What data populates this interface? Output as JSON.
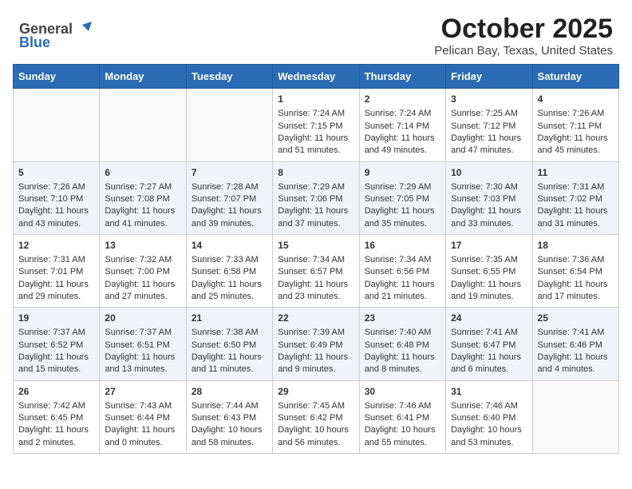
{
  "header": {
    "logo_general": "General",
    "logo_blue": "Blue",
    "title": "October 2025",
    "subtitle": "Pelican Bay, Texas, United States"
  },
  "days_of_week": [
    "Sunday",
    "Monday",
    "Tuesday",
    "Wednesday",
    "Thursday",
    "Friday",
    "Saturday"
  ],
  "weeks": [
    [
      {
        "day": "",
        "content": ""
      },
      {
        "day": "",
        "content": ""
      },
      {
        "day": "",
        "content": ""
      },
      {
        "day": "1",
        "content": "Sunrise: 7:24 AM\nSunset: 7:15 PM\nDaylight: 11 hours\nand 51 minutes."
      },
      {
        "day": "2",
        "content": "Sunrise: 7:24 AM\nSunset: 7:14 PM\nDaylight: 11 hours\nand 49 minutes."
      },
      {
        "day": "3",
        "content": "Sunrise: 7:25 AM\nSunset: 7:12 PM\nDaylight: 11 hours\nand 47 minutes."
      },
      {
        "day": "4",
        "content": "Sunrise: 7:26 AM\nSunset: 7:11 PM\nDaylight: 11 hours\nand 45 minutes."
      }
    ],
    [
      {
        "day": "5",
        "content": "Sunrise: 7:26 AM\nSunset: 7:10 PM\nDaylight: 11 hours\nand 43 minutes."
      },
      {
        "day": "6",
        "content": "Sunrise: 7:27 AM\nSunset: 7:08 PM\nDaylight: 11 hours\nand 41 minutes."
      },
      {
        "day": "7",
        "content": "Sunrise: 7:28 AM\nSunset: 7:07 PM\nDaylight: 11 hours\nand 39 minutes."
      },
      {
        "day": "8",
        "content": "Sunrise: 7:29 AM\nSunset: 7:06 PM\nDaylight: 11 hours\nand 37 minutes."
      },
      {
        "day": "9",
        "content": "Sunrise: 7:29 AM\nSunset: 7:05 PM\nDaylight: 11 hours\nand 35 minutes."
      },
      {
        "day": "10",
        "content": "Sunrise: 7:30 AM\nSunset: 7:03 PM\nDaylight: 11 hours\nand 33 minutes."
      },
      {
        "day": "11",
        "content": "Sunrise: 7:31 AM\nSunset: 7:02 PM\nDaylight: 11 hours\nand 31 minutes."
      }
    ],
    [
      {
        "day": "12",
        "content": "Sunrise: 7:31 AM\nSunset: 7:01 PM\nDaylight: 11 hours\nand 29 minutes."
      },
      {
        "day": "13",
        "content": "Sunrise: 7:32 AM\nSunset: 7:00 PM\nDaylight: 11 hours\nand 27 minutes."
      },
      {
        "day": "14",
        "content": "Sunrise: 7:33 AM\nSunset: 6:58 PM\nDaylight: 11 hours\nand 25 minutes."
      },
      {
        "day": "15",
        "content": "Sunrise: 7:34 AM\nSunset: 6:57 PM\nDaylight: 11 hours\nand 23 minutes."
      },
      {
        "day": "16",
        "content": "Sunrise: 7:34 AM\nSunset: 6:56 PM\nDaylight: 11 hours\nand 21 minutes."
      },
      {
        "day": "17",
        "content": "Sunrise: 7:35 AM\nSunset: 6:55 PM\nDaylight: 11 hours\nand 19 minutes."
      },
      {
        "day": "18",
        "content": "Sunrise: 7:36 AM\nSunset: 6:54 PM\nDaylight: 11 hours\nand 17 minutes."
      }
    ],
    [
      {
        "day": "19",
        "content": "Sunrise: 7:37 AM\nSunset: 6:52 PM\nDaylight: 11 hours\nand 15 minutes."
      },
      {
        "day": "20",
        "content": "Sunrise: 7:37 AM\nSunset: 6:51 PM\nDaylight: 11 hours\nand 13 minutes."
      },
      {
        "day": "21",
        "content": "Sunrise: 7:38 AM\nSunset: 6:50 PM\nDaylight: 11 hours\nand 11 minutes."
      },
      {
        "day": "22",
        "content": "Sunrise: 7:39 AM\nSunset: 6:49 PM\nDaylight: 11 hours\nand 9 minutes."
      },
      {
        "day": "23",
        "content": "Sunrise: 7:40 AM\nSunset: 6:48 PM\nDaylight: 11 hours\nand 8 minutes."
      },
      {
        "day": "24",
        "content": "Sunrise: 7:41 AM\nSunset: 6:47 PM\nDaylight: 11 hours\nand 6 minutes."
      },
      {
        "day": "25",
        "content": "Sunrise: 7:41 AM\nSunset: 6:46 PM\nDaylight: 11 hours\nand 4 minutes."
      }
    ],
    [
      {
        "day": "26",
        "content": "Sunrise: 7:42 AM\nSunset: 6:45 PM\nDaylight: 11 hours\nand 2 minutes."
      },
      {
        "day": "27",
        "content": "Sunrise: 7:43 AM\nSunset: 6:44 PM\nDaylight: 11 hours\nand 0 minutes."
      },
      {
        "day": "28",
        "content": "Sunrise: 7:44 AM\nSunset: 6:43 PM\nDaylight: 10 hours\nand 58 minutes."
      },
      {
        "day": "29",
        "content": "Sunrise: 7:45 AM\nSunset: 6:42 PM\nDaylight: 10 hours\nand 56 minutes."
      },
      {
        "day": "30",
        "content": "Sunrise: 7:46 AM\nSunset: 6:41 PM\nDaylight: 10 hours\nand 55 minutes."
      },
      {
        "day": "31",
        "content": "Sunrise: 7:46 AM\nSunset: 6:40 PM\nDaylight: 10 hours\nand 53 minutes."
      },
      {
        "day": "",
        "content": ""
      }
    ]
  ]
}
